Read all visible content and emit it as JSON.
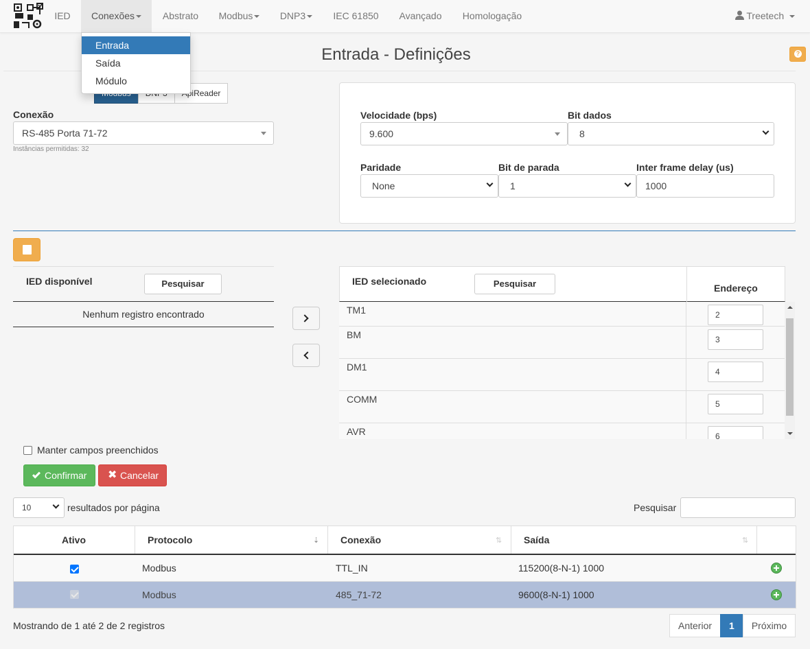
{
  "navbar": {
    "items": [
      "IED",
      "Conexões",
      "Abstrato",
      "Modbus",
      "DNP3",
      "IEC 61850",
      "Avançado",
      "Homologação"
    ],
    "user": "Treetech"
  },
  "dropdown": {
    "items": [
      "Entrada",
      "Saída",
      "Módulo"
    ]
  },
  "page": {
    "title": "Entrada - Definições"
  },
  "protocols": [
    "Modbus",
    "DNP3",
    "ApiReader"
  ],
  "conexao": {
    "label": "Conexão",
    "value": "RS-485 Porta 71-72",
    "help": "Instâncias permitidas: 32"
  },
  "serial": {
    "velocidade_label": "Velocidade (bps)",
    "velocidade": "9.600",
    "bitdados_label": "Bit dados",
    "bitdados": "8",
    "paridade_label": "Paridade",
    "paridade": "None",
    "bitparada_label": "Bit de parada",
    "bitparada": "1",
    "delay_label": "Inter frame delay (us)",
    "delay": "1000"
  },
  "ied_disponivel": {
    "title": "IED disponível",
    "search": "Pesquisar",
    "empty": "Nenhum registro encontrado"
  },
  "ied_selecionado": {
    "title": "IED selecionado",
    "search": "Pesquisar",
    "col_addr": "Endereço",
    "rows": [
      {
        "name": "TM1",
        "addr": "2"
      },
      {
        "name": "BM",
        "addr": "3"
      },
      {
        "name": "DM1",
        "addr": "4"
      },
      {
        "name": "COMM",
        "addr": "5"
      },
      {
        "name": "AVR",
        "addr": "6"
      }
    ]
  },
  "form": {
    "keep_label": "Manter campos preenchidos",
    "confirm": "Confirmar",
    "cancel": "Cancelar"
  },
  "table": {
    "page_size": "10",
    "page_size_label": "resultados por página",
    "search_label": "Pesquisar",
    "headers": [
      "Ativo",
      "Protocolo",
      "Conexão",
      "Saída"
    ],
    "rows": [
      {
        "active": true,
        "protocolo": "Modbus",
        "conexao": "TTL_IN",
        "saida": "115200(8-N-1) 1000"
      },
      {
        "active": true,
        "protocolo": "Modbus",
        "conexao": "485_71-72",
        "saida": "9600(8-N-1) 1000"
      }
    ],
    "info": "Mostrando de 1 até 2 de 2 registros",
    "pager": {
      "prev": "Anterior",
      "current": "1",
      "next": "Próximo"
    }
  },
  "colors": {
    "primary": "#337ab7",
    "warning": "#f0ad4e",
    "success": "#5cb85c",
    "danger": "#d9534f",
    "selected_row": "#b0bed9"
  }
}
